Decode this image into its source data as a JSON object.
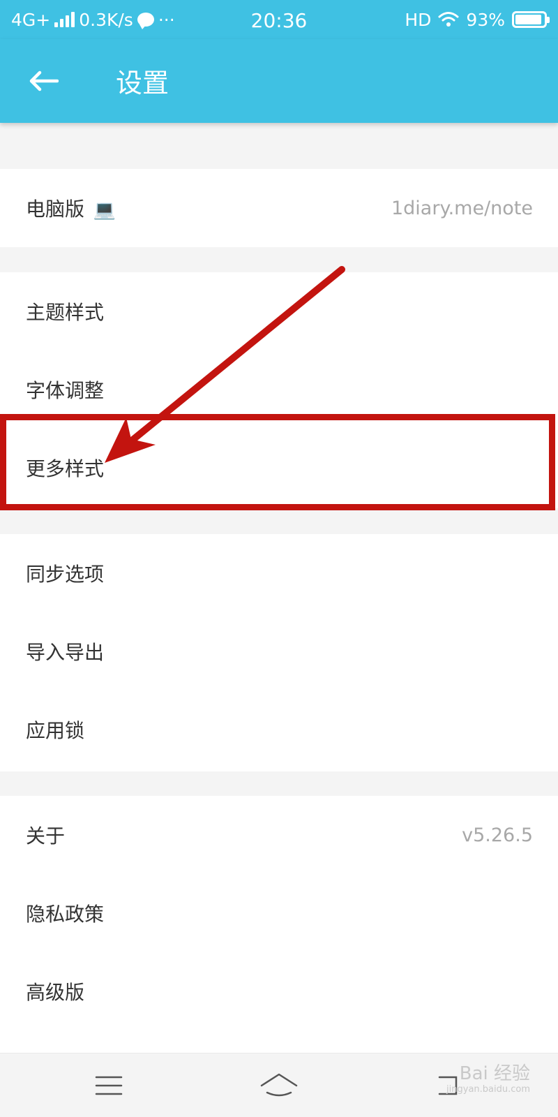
{
  "status_bar": {
    "network": "4G+",
    "speed": "0.3K/s",
    "more": "···",
    "time": "20:36",
    "hd": "HD",
    "battery": "93%",
    "battery_level": 0.93
  },
  "app_bar": {
    "title": "设置",
    "back_icon": "arrow-left-icon"
  },
  "sections": {
    "pc": {
      "label": "电脑版",
      "emoji": "💻",
      "value": "1diary.me/note"
    },
    "style": [
      {
        "label": "主题样式"
      },
      {
        "label": "字体调整"
      },
      {
        "label": "更多样式"
      }
    ],
    "data": [
      {
        "label": "同步选项"
      },
      {
        "label": "导入导出"
      },
      {
        "label": "应用锁"
      }
    ],
    "about": {
      "about_label": "关于",
      "version": "v5.26.5",
      "privacy_label": "隐私政策",
      "premium_label": "高级版"
    }
  },
  "nav_bar": {
    "icons": [
      "menu-icon",
      "home-icon",
      "back-icon"
    ]
  },
  "watermark": {
    "text": "Bai 经验",
    "url": "jingyan.baidu.com"
  },
  "colors": {
    "accent": "#3fc1e3",
    "annotation": "#c3140f",
    "background": "#f4f4f4"
  }
}
